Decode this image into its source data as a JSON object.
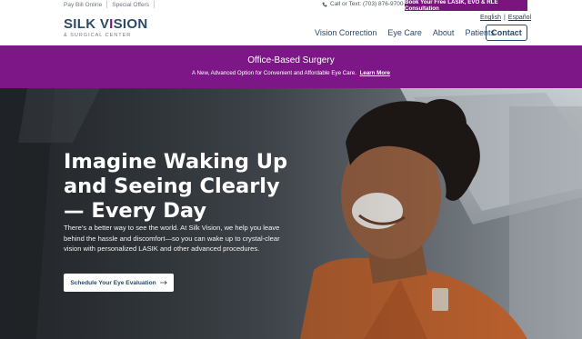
{
  "topbar": {
    "pay_bill": "Pay Bill Online",
    "special_offers": "Special Offers",
    "phone": "Call or Text: (703) 876-9700",
    "consult_button": "Book Your Free LASIK, EVO & RLE Consultation"
  },
  "header": {
    "logo_main_pre": "SILK V",
    "logo_main_accent": "I",
    "logo_main_post": "SION",
    "logo_sub": "& SURGICAL CENTER",
    "lang_en": "English",
    "lang_divider": "|",
    "lang_es": "Español",
    "nav": [
      "Vision Correction",
      "Eye Care",
      "About",
      "Patients"
    ],
    "contact": "Contact"
  },
  "banner": {
    "title": "Office-Based Surgery",
    "subtitle": "A New, Advanced Option for Convenient and Affordable Eye Care.",
    "link": "Learn More"
  },
  "hero": {
    "title": "Imagine Waking Up and Seeing Clearly — Every Day",
    "text": "There’s a better way to see the world. At Silk Vision, we help you leave behind the hassle and discomfort—so you can wake up to crystal-clear vision with personalized LASIK and other advanced procedures.",
    "button": "Schedule Your Eye Evaluation"
  },
  "colors": {
    "brand_purple": "#7a1580",
    "brand_navy": "#2b4a6a"
  }
}
